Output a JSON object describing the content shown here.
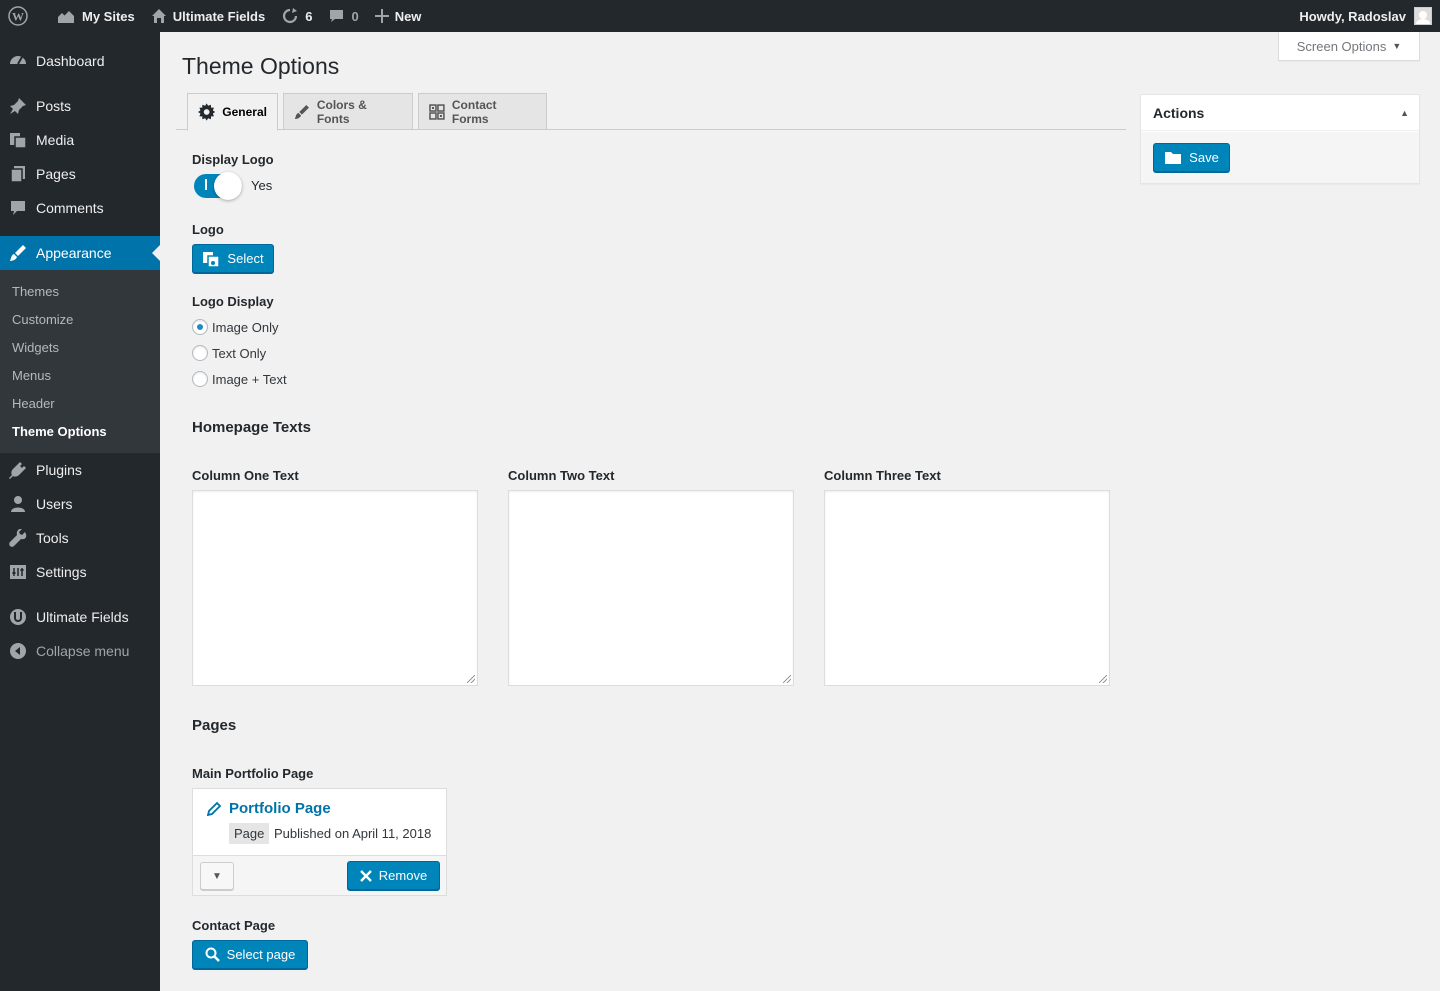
{
  "adminbar": {
    "my_sites": "My Sites",
    "site_name": "Ultimate Fields",
    "updates_count": "6",
    "comments_count": "0",
    "new_label": "New",
    "greeting": "Howdy, Radoslav"
  },
  "sidebar": {
    "items": [
      {
        "label": "Dashboard",
        "icon": "dashboard-icon"
      },
      {
        "label": "Posts",
        "icon": "pin-icon"
      },
      {
        "label": "Media",
        "icon": "media-icon"
      },
      {
        "label": "Pages",
        "icon": "page-icon"
      },
      {
        "label": "Comments",
        "icon": "comment-icon"
      },
      {
        "label": "Appearance",
        "icon": "brush-icon"
      },
      {
        "label": "Plugins",
        "icon": "plug-icon"
      },
      {
        "label": "Users",
        "icon": "user-icon"
      },
      {
        "label": "Tools",
        "icon": "wrench-icon"
      },
      {
        "label": "Settings",
        "icon": "settings-icon"
      },
      {
        "label": "Ultimate Fields",
        "icon": "ultimate-fields-icon"
      },
      {
        "label": "Collapse menu",
        "icon": "collapse-icon"
      }
    ],
    "submenu": [
      "Themes",
      "Customize",
      "Widgets",
      "Menus",
      "Header",
      "Theme Options"
    ]
  },
  "screen_options": "Screen Options",
  "page_title": "Theme Options",
  "tabs": [
    "General",
    "Colors & Fonts",
    "Contact Forms"
  ],
  "fields": {
    "display_logo": {
      "label": "Display Logo",
      "state_text": "Yes",
      "checked": true
    },
    "logo": {
      "label": "Logo",
      "button": "Select"
    },
    "logo_display": {
      "label": "Logo Display",
      "options": [
        "Image Only",
        "Text Only",
        "Image + Text"
      ],
      "selected": "Image Only"
    },
    "homepage_texts_heading": "Homepage Texts",
    "columns": [
      "Column One Text",
      "Column Two Text",
      "Column Three Text"
    ],
    "pages_heading": "Pages",
    "main_portfolio": {
      "label": "Main Portfolio Page",
      "title": "Portfolio Page",
      "type": "Page",
      "date": "Published on April 11, 2018",
      "remove": "Remove"
    },
    "contact_page": {
      "label": "Contact Page",
      "button": "Select page"
    }
  },
  "actions": {
    "title": "Actions",
    "save": "Save"
  },
  "colors": {
    "primary": "#0085ba",
    "sidebar": "#23282d",
    "active": "#0073aa"
  }
}
